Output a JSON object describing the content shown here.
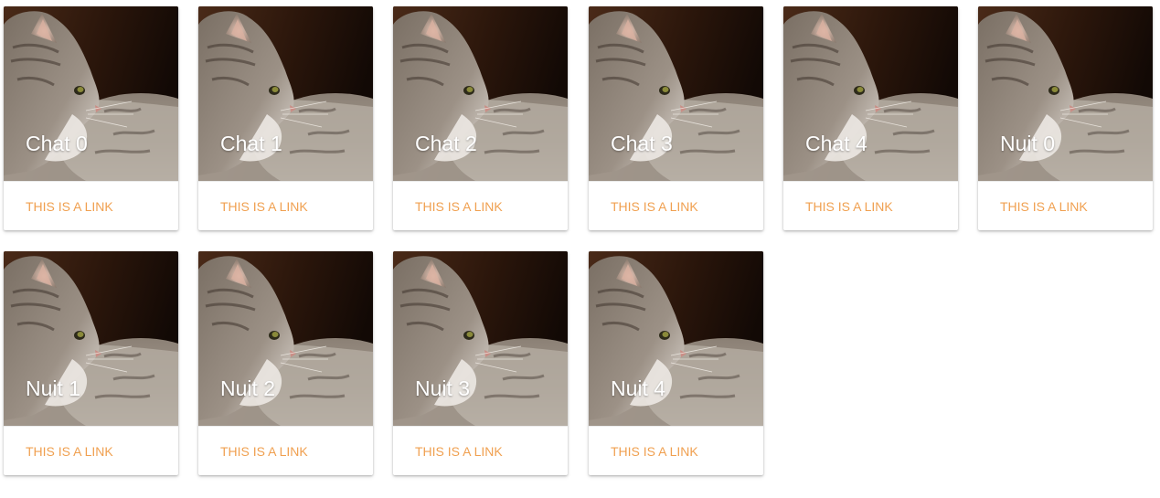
{
  "cards": [
    {
      "title": "Chat 0",
      "link": "THIS IS A LINK",
      "image": "cat-photo"
    },
    {
      "title": "Chat 1",
      "link": "THIS IS A LINK",
      "image": "cat-photo"
    },
    {
      "title": "Chat 2",
      "link": "THIS IS A LINK",
      "image": "cat-photo"
    },
    {
      "title": "Chat 3",
      "link": "THIS IS A LINK",
      "image": "cat-photo"
    },
    {
      "title": "Chat 4",
      "link": "THIS IS A LINK",
      "image": "cat-photo"
    },
    {
      "title": "Nuit 0",
      "link": "THIS IS A LINK",
      "image": "cat-photo"
    },
    {
      "title": "Nuit 1",
      "link": "THIS IS A LINK",
      "image": "cat-photo"
    },
    {
      "title": "Nuit 2",
      "link": "THIS IS A LINK",
      "image": "cat-photo"
    },
    {
      "title": "Nuit 3",
      "link": "THIS IS A LINK",
      "image": "cat-photo"
    },
    {
      "title": "Nuit 4",
      "link": "THIS IS A LINK",
      "image": "cat-photo"
    }
  ],
  "colors": {
    "link": "#f0a050",
    "title": "#ffffff",
    "card_background": "#ffffff"
  }
}
